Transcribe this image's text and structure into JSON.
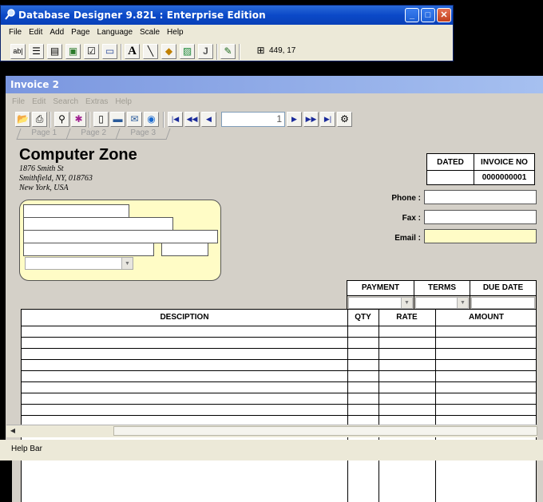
{
  "designer": {
    "title": "Database Designer 9.82L : Enterprise Edition",
    "menu": [
      "File",
      "Edit",
      "Add",
      "Page",
      "Language",
      "Scale",
      "Help"
    ],
    "toolbar_icons": [
      "text-field-icon",
      "list-icon",
      "memo-icon",
      "image-field-icon",
      "checkbox-icon",
      "button-icon",
      "text-label-icon",
      "line-icon",
      "shape-icon",
      "picture-icon",
      "j-icon",
      "signature-icon"
    ],
    "coordinates": "449, 17"
  },
  "invoice_window": {
    "title": "Invoice 2",
    "menu": [
      "File",
      "Edit",
      "Search",
      "Extras",
      "Help"
    ],
    "record_number": "1",
    "tabs": [
      "Page 1",
      "Page 2",
      "Page 3"
    ]
  },
  "form": {
    "company_name": "Computer Zone",
    "address": [
      "1876 Smith St",
      "Smithfield, NY, 018763",
      "New York, USA"
    ],
    "dated_label": "DATED",
    "invoice_no_label": "INVOICE NO",
    "invoice_no_value": "0000000001",
    "dated_value": "",
    "phone_label": "Phone :",
    "fax_label": "Fax :",
    "email_label": "Email :",
    "payment_label": "PAYMENT",
    "terms_label": "TERMS",
    "due_date_label": "DUE DATE",
    "columns": [
      "DESCIPTION",
      "QTY",
      "RATE",
      "AMOUNT"
    ]
  },
  "status_bar": "Help Bar",
  "colors": {
    "title_active": "#0b49c8",
    "title_inactive": "#7a96df",
    "highlight_field": "#fffcc6",
    "page_bg": "#d4d0c8"
  }
}
